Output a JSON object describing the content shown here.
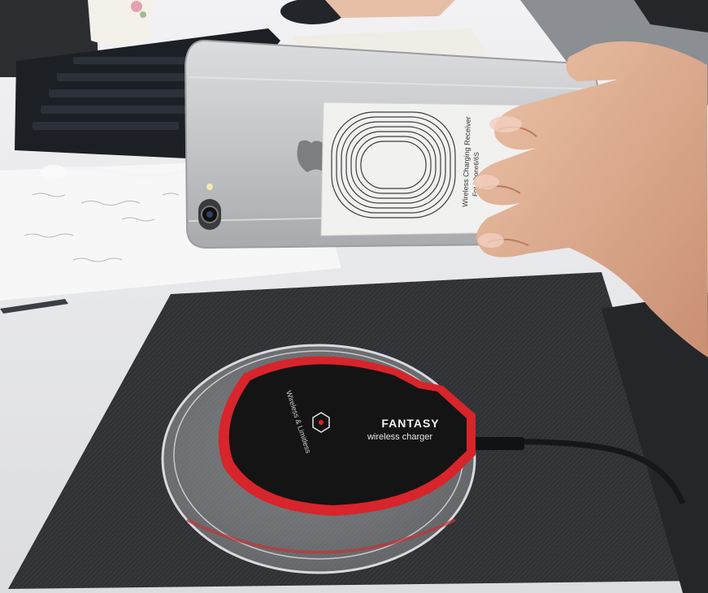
{
  "photo": {
    "subject": "phone-with-wireless-receiver-over-charging-pad",
    "charger": {
      "brand": "FANTASY",
      "tagline": "wireless charger",
      "ring_text": "Wireless & Limitless"
    },
    "receiver_card": {
      "side_text": "Wireless Charging Receiver",
      "side_text_2": "For iphone6/6S"
    },
    "colors": {
      "desk": "#e8e9ec",
      "mat": "#2f3134",
      "phone": "#c9cacd",
      "card": "#f1f1ef",
      "charger_red": "#d8242b",
      "charger_black": "#141414",
      "skin": "#e0b49a",
      "keyboard": "#1c1f24"
    }
  }
}
